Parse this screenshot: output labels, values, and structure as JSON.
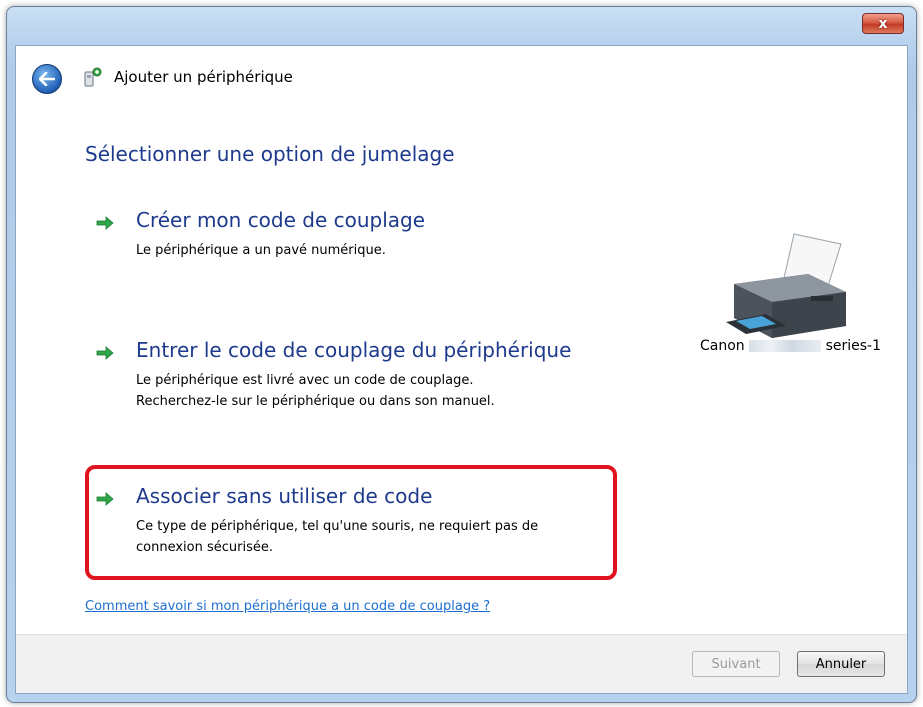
{
  "window": {
    "title": "Ajouter un périphérique",
    "close_label": "x"
  },
  "page": {
    "heading": "Sélectionner une option de jumelage"
  },
  "options": [
    {
      "title": "Créer mon code de couplage",
      "description": [
        "Le périphérique a un pavé numérique."
      ]
    },
    {
      "title": "Entrer le code de couplage du périphérique",
      "description": [
        "Le périphérique est livré avec un code de couplage.",
        "Recherchez-le sur le périphérique ou dans son manuel."
      ]
    },
    {
      "title": "Associer sans utiliser de code",
      "description": [
        "Ce type de périphérique, tel qu'une souris, ne requiert pas de",
        "connexion sécurisée."
      ],
      "highlighted": true
    }
  ],
  "help_link": "Comment savoir si mon périphérique a un code de couplage ?",
  "device": {
    "name_prefix": "Canon",
    "name_suffix": "series-1",
    "icon": "printer-icon"
  },
  "buttons": {
    "next": "Suivant",
    "cancel": "Annuler"
  },
  "colors": {
    "heading": "#1e3a8c",
    "link": "#1f6fd0",
    "highlight": "#e0141e",
    "arrow": "#2fa64a"
  }
}
